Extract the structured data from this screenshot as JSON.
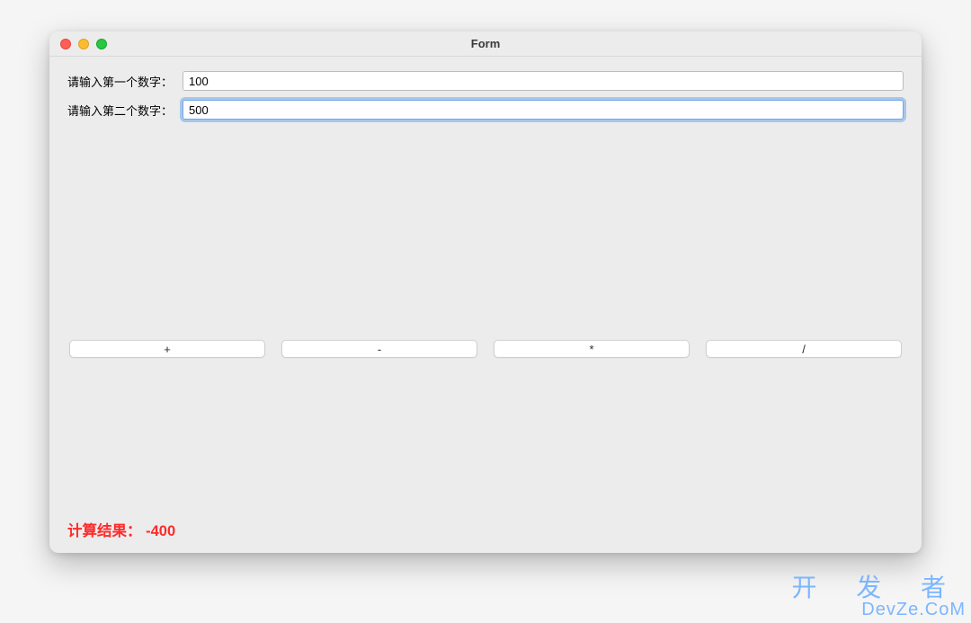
{
  "window": {
    "title": "Form"
  },
  "inputs": {
    "first": {
      "label": "请输入第一个数字：",
      "value": "100"
    },
    "second": {
      "label": "请输入第二个数字：",
      "value": "500"
    }
  },
  "ops": {
    "add": "+",
    "sub": "-",
    "mul": "*",
    "div": "/"
  },
  "result": {
    "label": "计算结果：",
    "value": "-400"
  },
  "watermark": {
    "line1": "开 发 者",
    "line2": "DevZe.CoM"
  }
}
